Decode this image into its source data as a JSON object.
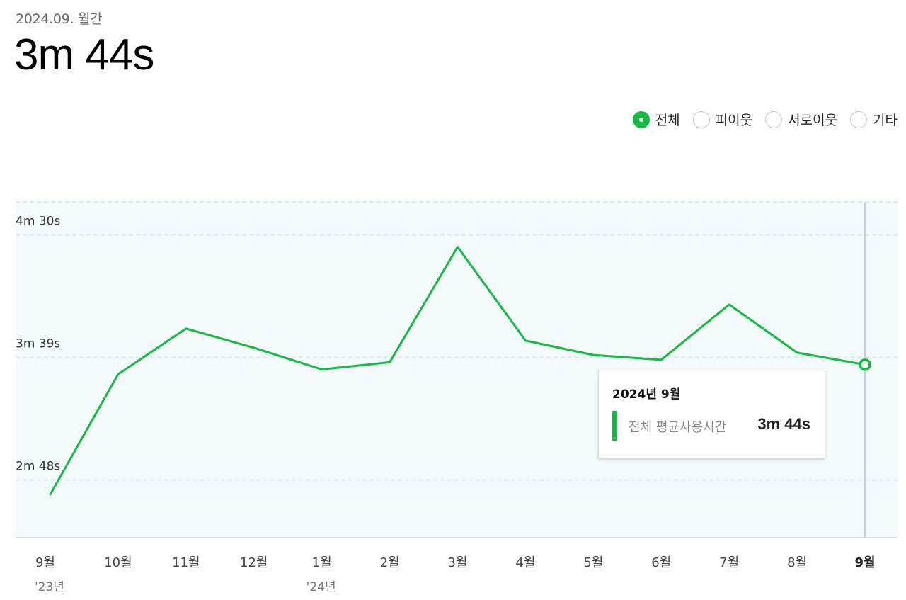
{
  "header": {
    "period": "2024.09. 월간",
    "value": "3m 44s"
  },
  "filters": [
    {
      "label": "전체",
      "checked": true
    },
    {
      "label": "피이웃",
      "checked": false
    },
    {
      "label": "서로이웃",
      "checked": false
    },
    {
      "label": "기타",
      "checked": false
    }
  ],
  "colors": {
    "line": "#11bd3e",
    "plot_bg": "#f5fafd",
    "grid": "#dbe7f1",
    "cursor": "#c9ced3"
  },
  "tooltip": {
    "title": "2024년 9월",
    "label": "전체 평균사용시간",
    "value": "3m 44s"
  },
  "chart_data": {
    "type": "line",
    "title": "",
    "xlabel": "",
    "ylabel": "",
    "categories": [
      "9월",
      "10월",
      "11월",
      "12월",
      "1월",
      "2월",
      "3월",
      "4월",
      "5월",
      "6월",
      "7월",
      "8월",
      "9월"
    ],
    "year_labels": [
      "'23년",
      "",
      "",
      "",
      "'24년",
      "",
      "",
      "",
      "",
      "",
      "",
      "",
      ""
    ],
    "y_unit": "seconds",
    "ylim": [
      144,
      284
    ],
    "y_ticks": [
      {
        "value": 168,
        "label": "2m 48s"
      },
      {
        "value": 219,
        "label": "3m 39s"
      },
      {
        "value": 270,
        "label": "4m 30s"
      }
    ],
    "series": [
      {
        "values": [
          162,
          212,
          231,
          223,
          214,
          217,
          265,
          226,
          220,
          218,
          241,
          221,
          216
        ]
      }
    ],
    "highlight_index": 12,
    "grid": true
  }
}
